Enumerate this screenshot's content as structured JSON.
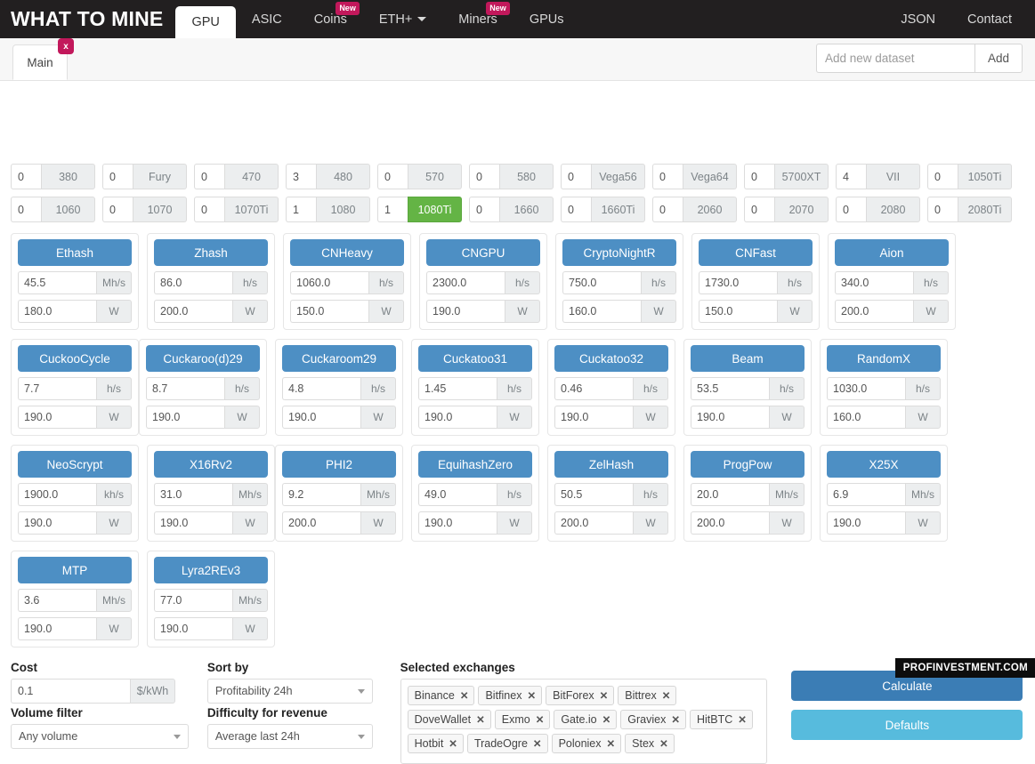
{
  "brand": "WHAT TO MINE",
  "nav": {
    "items": [
      {
        "label": "GPU",
        "active": true,
        "badge": "",
        "caret": false
      },
      {
        "label": "ASIC",
        "active": false,
        "badge": "",
        "caret": false
      },
      {
        "label": "Coins",
        "active": false,
        "badge": "New",
        "caret": false
      },
      {
        "label": "ETH+",
        "active": false,
        "badge": "",
        "caret": true
      },
      {
        "label": "Miners",
        "active": false,
        "badge": "New",
        "caret": false
      },
      {
        "label": "GPUs",
        "active": false,
        "badge": "",
        "caret": false
      }
    ],
    "right": [
      {
        "label": "JSON"
      },
      {
        "label": "Contact"
      }
    ]
  },
  "dataset": {
    "tab_label": "Main",
    "tab_close": "x",
    "placeholder": "Add new dataset",
    "input_value": "",
    "add_label": "Add"
  },
  "gpus": {
    "row1": [
      {
        "qty": "0",
        "label": "380",
        "selected": false
      },
      {
        "qty": "0",
        "label": "Fury",
        "selected": false
      },
      {
        "qty": "0",
        "label": "470",
        "selected": false
      },
      {
        "qty": "3",
        "label": "480",
        "selected": false
      },
      {
        "qty": "0",
        "label": "570",
        "selected": false
      },
      {
        "qty": "0",
        "label": "580",
        "selected": false
      },
      {
        "qty": "0",
        "label": "Vega56",
        "selected": false
      },
      {
        "qty": "0",
        "label": "Vega64",
        "selected": false
      },
      {
        "qty": "0",
        "label": "5700XT",
        "selected": false
      },
      {
        "qty": "4",
        "label": "VII",
        "selected": false
      },
      {
        "qty": "0",
        "label": "1050Ti",
        "selected": false
      }
    ],
    "row2": [
      {
        "qty": "0",
        "label": "1060",
        "selected": false
      },
      {
        "qty": "0",
        "label": "1070",
        "selected": false
      },
      {
        "qty": "0",
        "label": "1070Ti",
        "selected": false
      },
      {
        "qty": "1",
        "label": "1080",
        "selected": false
      },
      {
        "qty": "1",
        "label": "1080Ti",
        "selected": true
      },
      {
        "qty": "0",
        "label": "1660",
        "selected": false
      },
      {
        "qty": "0",
        "label": "1660Ti",
        "selected": false
      },
      {
        "qty": "0",
        "label": "2060",
        "selected": false
      },
      {
        "qty": "0",
        "label": "2070",
        "selected": false
      },
      {
        "qty": "0",
        "label": "2080",
        "selected": false
      },
      {
        "qty": "0",
        "label": "2080Ti",
        "selected": false
      }
    ]
  },
  "algos": [
    {
      "name": "Ethash",
      "rate": "45.5",
      "rate_unit": "Mh/s",
      "power": "180.0",
      "power_unit": "W"
    },
    {
      "name": "Zhash",
      "rate": "86.0",
      "rate_unit": "h/s",
      "power": "200.0",
      "power_unit": "W"
    },
    {
      "name": "CNHeavy",
      "rate": "1060.0",
      "rate_unit": "h/s",
      "power": "150.0",
      "power_unit": "W"
    },
    {
      "name": "CNGPU",
      "rate": "2300.0",
      "rate_unit": "h/s",
      "power": "190.0",
      "power_unit": "W"
    },
    {
      "name": "CryptoNightR",
      "rate": "750.0",
      "rate_unit": "h/s",
      "power": "160.0",
      "power_unit": "W"
    },
    {
      "name": "CNFast",
      "rate": "1730.0",
      "rate_unit": "h/s",
      "power": "150.0",
      "power_unit": "W"
    },
    {
      "name": "Aion",
      "rate": "340.0",
      "rate_unit": "h/s",
      "power": "200.0",
      "power_unit": "W"
    },
    {
      "name": "CuckooCycle",
      "rate": "7.7",
      "rate_unit": "h/s",
      "power": "190.0",
      "power_unit": "W"
    },
    {
      "name": "Cuckaroo(d)29",
      "rate": "8.7",
      "rate_unit": "h/s",
      "power": "190.0",
      "power_unit": "W"
    },
    {
      "name": "Cuckaroom29",
      "rate": "4.8",
      "rate_unit": "h/s",
      "power": "190.0",
      "power_unit": "W"
    },
    {
      "name": "Cuckatoo31",
      "rate": "1.45",
      "rate_unit": "h/s",
      "power": "190.0",
      "power_unit": "W"
    },
    {
      "name": "Cuckatoo32",
      "rate": "0.46",
      "rate_unit": "h/s",
      "power": "190.0",
      "power_unit": "W"
    },
    {
      "name": "Beam",
      "rate": "53.5",
      "rate_unit": "h/s",
      "power": "190.0",
      "power_unit": "W"
    },
    {
      "name": "RandomX",
      "rate": "1030.0",
      "rate_unit": "h/s",
      "power": "160.0",
      "power_unit": "W"
    },
    {
      "name": "NeoScrypt",
      "rate": "1900.0",
      "rate_unit": "kh/s",
      "power": "190.0",
      "power_unit": "W"
    },
    {
      "name": "X16Rv2",
      "rate": "31.0",
      "rate_unit": "Mh/s",
      "power": "190.0",
      "power_unit": "W"
    },
    {
      "name": "PHI2",
      "rate": "9.2",
      "rate_unit": "Mh/s",
      "power": "200.0",
      "power_unit": "W"
    },
    {
      "name": "EquihashZero",
      "rate": "49.0",
      "rate_unit": "h/s",
      "power": "190.0",
      "power_unit": "W"
    },
    {
      "name": "ZelHash",
      "rate": "50.5",
      "rate_unit": "h/s",
      "power": "200.0",
      "power_unit": "W"
    },
    {
      "name": "ProgPow",
      "rate": "20.0",
      "rate_unit": "Mh/s",
      "power": "200.0",
      "power_unit": "W"
    },
    {
      "name": "X25X",
      "rate": "6.9",
      "rate_unit": "Mh/s",
      "power": "190.0",
      "power_unit": "W"
    },
    {
      "name": "MTP",
      "rate": "3.6",
      "rate_unit": "Mh/s",
      "power": "190.0",
      "power_unit": "W"
    },
    {
      "name": "Lyra2REv3",
      "rate": "77.0",
      "rate_unit": "Mh/s",
      "power": "190.0",
      "power_unit": "W"
    }
  ],
  "controls": {
    "cost_label": "Cost",
    "cost_value": "0.1",
    "cost_unit": "$/kWh",
    "volume_label": "Volume filter",
    "volume_value": "Any volume",
    "sort_label": "Sort by",
    "sort_value": "Profitability 24h",
    "difficulty_label": "Difficulty for revenue",
    "difficulty_value": "Average last 24h",
    "exchanges_label": "Selected exchanges",
    "exchanges": [
      "Binance",
      "Bitfinex",
      "BitForex",
      "Bittrex",
      "DoveWallet",
      "Exmo",
      "Gate.io",
      "Graviex",
      "HitBTC",
      "Hotbit",
      "TradeOgre",
      "Poloniex",
      "Stex"
    ],
    "chip_remove": "✕",
    "calculate_label": "Calculate",
    "defaults_label": "Defaults"
  },
  "watermark": "PROFINVESTMENT.COM",
  "colors": {
    "navbar_bg": "#221f20",
    "accent_blue": "#4d8fc4",
    "calculate_blue": "#3b7db5",
    "defaults_blue": "#57bbdd",
    "selected_green": "#64b445",
    "badge_pink": "#c2185b"
  }
}
